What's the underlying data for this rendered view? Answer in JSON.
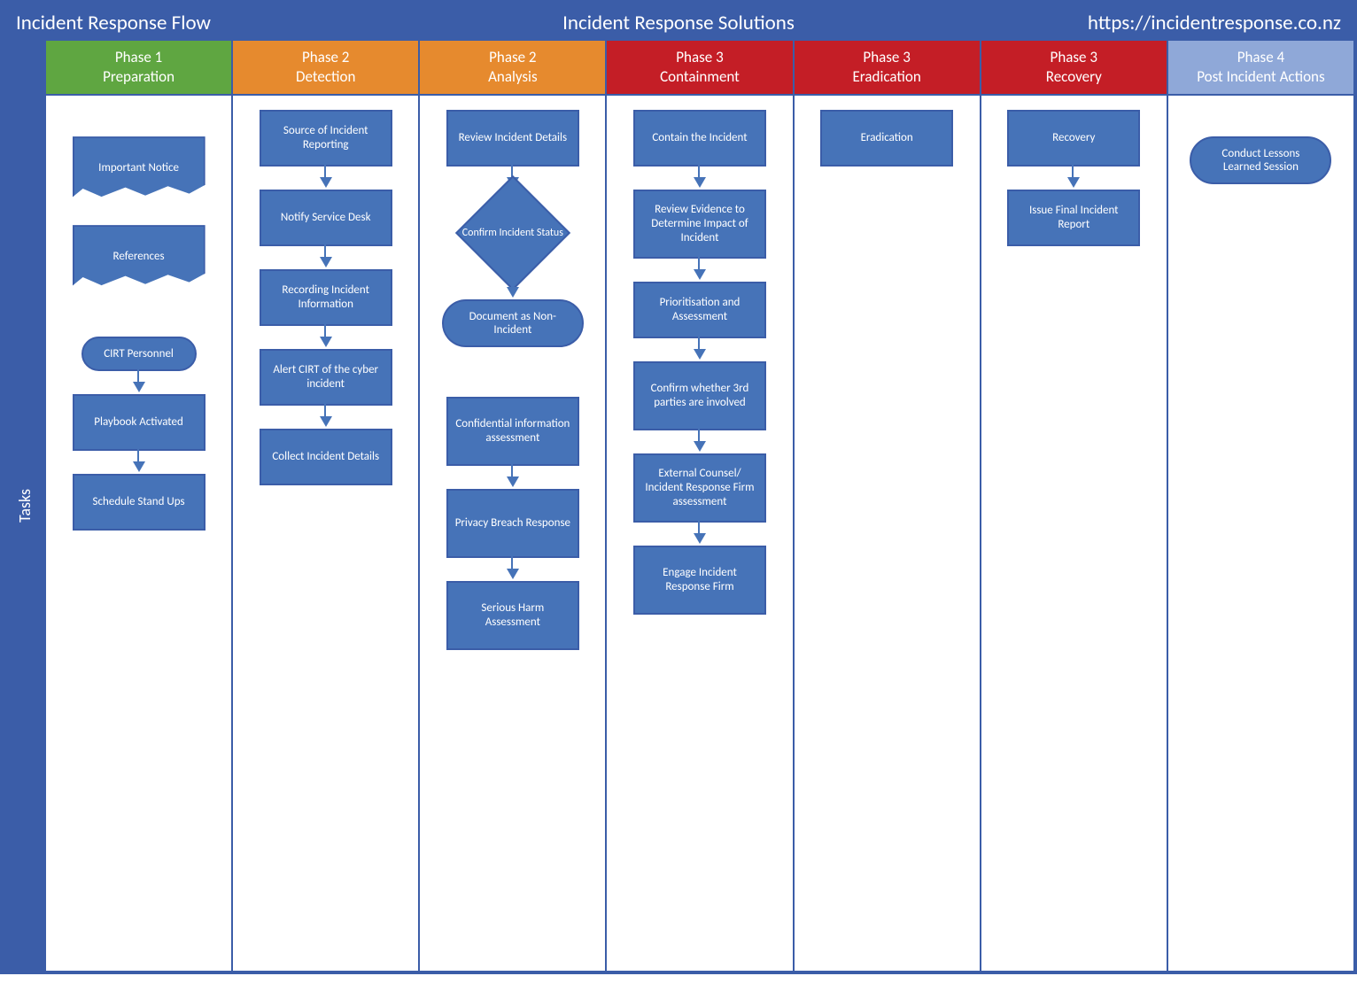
{
  "header": {
    "left": "Incident Response Flow",
    "center": "Incident Response Solutions",
    "right": "https://incidentresponse.co.nz"
  },
  "row_label": "Tasks",
  "lanes": [
    {
      "title_l1": "Phase 1",
      "title_l2": "Preparation",
      "color": "green",
      "items": [
        {
          "shape": "wavy",
          "text": "Important Notice"
        },
        {
          "shape": "wavy",
          "text": "References"
        },
        {
          "shape": "pill",
          "text": "CIRT Personnel"
        },
        {
          "shape": "rect",
          "text": "Playbook Activated"
        },
        {
          "shape": "rect",
          "text": "Schedule Stand Ups"
        }
      ]
    },
    {
      "title_l1": "Phase 2",
      "title_l2": "Detection",
      "color": "orange",
      "items": [
        {
          "shape": "rect",
          "text": "Source of Incident Reporting"
        },
        {
          "shape": "rect",
          "text": "Notify Service Desk"
        },
        {
          "shape": "rect",
          "text": "Recording Incident Information"
        },
        {
          "shape": "rect",
          "text": "Alert CIRT of the cyber incident"
        },
        {
          "shape": "rect",
          "text": "Collect Incident Details"
        }
      ]
    },
    {
      "title_l1": "Phase 2",
      "title_l2": "Analysis",
      "color": "orange",
      "items": [
        {
          "shape": "rect",
          "text": "Review Incident Details"
        },
        {
          "shape": "diamond",
          "text": "Confirm Incident Status"
        },
        {
          "shape": "pill",
          "text": "Document as Non-Incident"
        },
        {
          "shape": "rect",
          "text": "Confidential information assessment"
        },
        {
          "shape": "rect",
          "text": "Privacy Breach Response"
        },
        {
          "shape": "rect",
          "text": "Serious Harm Assessment"
        }
      ]
    },
    {
      "title_l1": "Phase 3",
      "title_l2": "Containment",
      "color": "red",
      "items": [
        {
          "shape": "rect",
          "text": "Contain the Incident"
        },
        {
          "shape": "rect",
          "text": "Review Evidence to Determine Impact of Incident"
        },
        {
          "shape": "rect",
          "text": "Prioritisation and Assessment"
        },
        {
          "shape": "rect",
          "text": "Confirm whether 3rd parties are involved"
        },
        {
          "shape": "rect",
          "text": "External Counsel/ Incident Response Firm assessment"
        },
        {
          "shape": "rect",
          "text": "Engage Incident Response Firm"
        }
      ]
    },
    {
      "title_l1": "Phase 3",
      "title_l2": "Eradication",
      "color": "red",
      "items": [
        {
          "shape": "rect",
          "text": "Eradication"
        }
      ]
    },
    {
      "title_l1": "Phase 3",
      "title_l2": "Recovery",
      "color": "red",
      "items": [
        {
          "shape": "rect",
          "text": "Recovery"
        },
        {
          "shape": "rect",
          "text": "Issue Final Incident Report"
        }
      ]
    },
    {
      "title_l1": "Phase 4",
      "title_l2": "Post Incident Actions",
      "color": "blue",
      "items": [
        {
          "shape": "pill",
          "text": "Conduct Lessons Learned Session"
        }
      ]
    }
  ]
}
